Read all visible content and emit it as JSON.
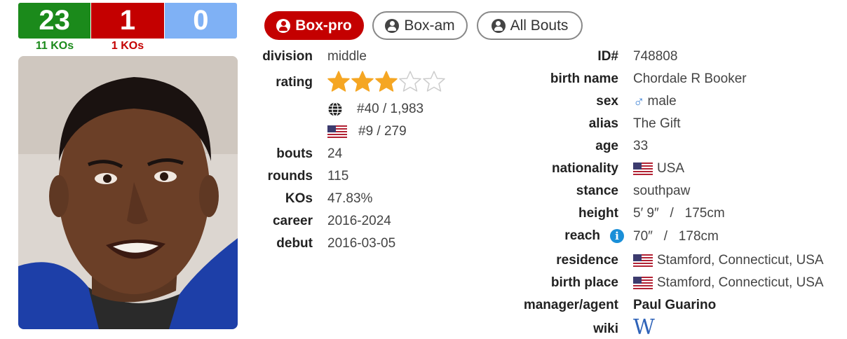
{
  "record": {
    "wins": "23",
    "losses": "1",
    "draws": "0",
    "win_kos": "11 KOs",
    "loss_kos": "1 KOs"
  },
  "tabs": [
    {
      "label": "Box-pro",
      "active": true
    },
    {
      "label": "Box-am",
      "active": false
    },
    {
      "label": "All Bouts",
      "active": false
    }
  ],
  "left": {
    "division_label": "division",
    "division": "middle",
    "rating_label": "rating",
    "rating_stars": 3,
    "rating_max": 5,
    "world_rank": "#40 / 1,983",
    "country_rank": "#9 / 279",
    "bouts_label": "bouts",
    "bouts": "24",
    "rounds_label": "rounds",
    "rounds": "115",
    "kos_label": "KOs",
    "kos": "47.83%",
    "career_label": "career",
    "career": "2016-2024",
    "debut_label": "debut",
    "debut": "2016-03-05"
  },
  "right": {
    "id_label": "ID#",
    "id": "748808",
    "birthname_label": "birth name",
    "birthname": "Chordale R Booker",
    "sex_label": "sex",
    "sex": "male",
    "alias_label": "alias",
    "alias": "The Gift",
    "age_label": "age",
    "age": "33",
    "nationality_label": "nationality",
    "nationality": "USA",
    "stance_label": "stance",
    "stance": "southpaw",
    "height_label": "height",
    "height": "5′ 9″   /   175cm",
    "reach_label": "reach",
    "reach": "70″   /   178cm",
    "residence_label": "residence",
    "residence": "Stamford, Connecticut, USA",
    "birthplace_label": "birth place",
    "birthplace": "Stamford, Connecticut, USA",
    "manager_label": "manager/agent",
    "manager": "Paul Guarino",
    "wiki_label": "wiki",
    "wiki_glyph": "W"
  },
  "colors": {
    "win": "#1b8a1b",
    "loss": "#c40000",
    "draw": "#7fb1f5",
    "star": "#f5a623",
    "link": "#1a8fd8"
  }
}
